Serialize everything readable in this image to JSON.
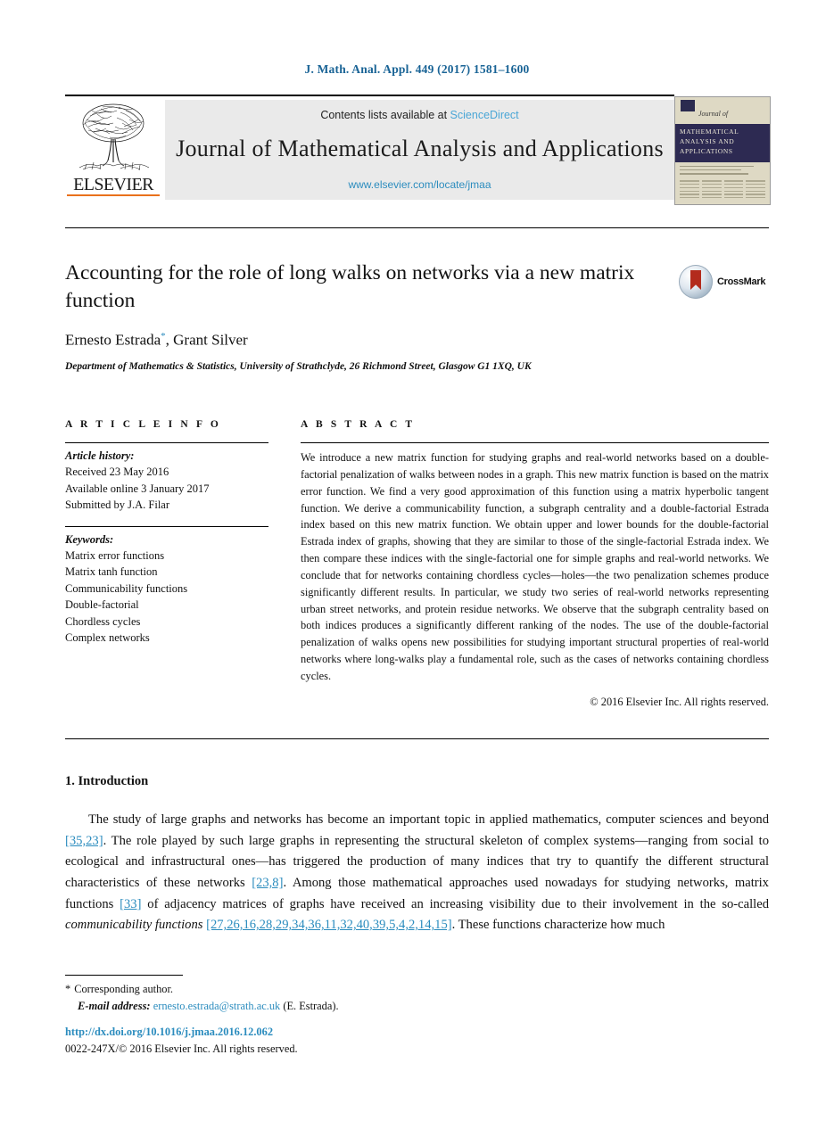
{
  "running_head": "J. Math. Anal. Appl. 449 (2017) 1581–1600",
  "masthead": {
    "contents_prefix": "Contents lists available at ",
    "sciencedirect": "ScienceDirect",
    "journal_title": "Journal of Mathematical Analysis and Applications",
    "journal_url": "www.elsevier.com/locate/jmaa",
    "publisher": "ELSEVIER",
    "cover": {
      "script": "Journal of",
      "band": "MATHEMATICAL ANALYSIS AND APPLICATIONS"
    }
  },
  "article": {
    "title": "Accounting for the role of long walks on networks via a new matrix function",
    "authors": "Ernesto Estrada",
    "author_marker": "*",
    "authors_rest": ", Grant Silver",
    "affiliation": "Department of Mathematics & Statistics, University of Strathclyde, 26 Richmond Street, Glasgow G1 1XQ, UK",
    "crossmark_label": "CrossMark"
  },
  "info": {
    "heading": "A R T I C L E   I N F O",
    "history_label": "Article history:",
    "history": [
      "Received 23 May 2016",
      "Available online 3 January 2017",
      "Submitted by J.A. Filar"
    ],
    "keywords_label": "Keywords:",
    "keywords": [
      "Matrix error functions",
      "Matrix tanh function",
      "Communicability functions",
      "Double-factorial",
      "Chordless cycles",
      "Complex networks"
    ]
  },
  "abstract": {
    "heading": "A B S T R A C T",
    "text": "We introduce a new matrix function for studying graphs and real-world networks based on a double-factorial penalization of walks between nodes in a graph. This new matrix function is based on the matrix error function. We find a very good approximation of this function using a matrix hyperbolic tangent function. We derive a communicability function, a subgraph centrality and a double-factorial Estrada index based on this new matrix function. We obtain upper and lower bounds for the double-factorial Estrada index of graphs, showing that they are similar to those of the single-factorial Estrada index. We then compare these indices with the single-factorial one for simple graphs and real-world networks. We conclude that for networks containing chordless cycles—holes—the two penalization schemes produce significantly different results. In particular, we study two series of real-world networks representing urban street networks, and protein residue networks. We observe that the subgraph centrality based on both indices produces a significantly different ranking of the nodes. The use of the double-factorial penalization of walks opens new possibilities for studying important structural properties of real-world networks where long-walks play a fundamental role, such as the cases of networks containing chordless cycles.",
    "copyright": "© 2016 Elsevier Inc. All rights reserved."
  },
  "section": {
    "number_title": "1. Introduction",
    "para": {
      "t1": "The study of large graphs and networks has become an important topic in applied mathematics, computer sciences and beyond ",
      "c1": "[35,23]",
      "t2": ". The role played by such large graphs in representing the structural skeleton of complex systems—ranging from social to ecological and infrastructural ones—has triggered the production of many indices that try to quantify the different structural characteristics of these networks ",
      "c2": "[23,8]",
      "t3": ". Among those mathematical approaches used nowadays for studying networks, matrix functions ",
      "c3": "[33]",
      "t4": " of adjacency matrices of graphs have received an increasing visibility due to their involvement in the so-called ",
      "i1": "communicability functions",
      "t5": " ",
      "c4": "[27,26,16,28,29,34,36,11,32,40,39,5,4,2,14,15]",
      "t6": ". These functions characterize how much"
    }
  },
  "footnotes": {
    "corresponding": "Corresponding author.",
    "star": "*",
    "email_label": "E-mail address:",
    "email": "ernesto.estrada@strath.ac.uk",
    "email_suffix": "(E. Estrada).",
    "doi": "http://dx.doi.org/10.1016/j.jmaa.2016.12.062",
    "issn": "0022-247X/© 2016 Elsevier Inc. All rights reserved."
  },
  "colors": {
    "link_blue": "#2b8cbe",
    "sciencedirect_blue": "#4aa6d6",
    "elsevier_orange": "#E9711C",
    "crossmark_red": "#b32b1c",
    "cover_navy": "#2d2a52"
  }
}
